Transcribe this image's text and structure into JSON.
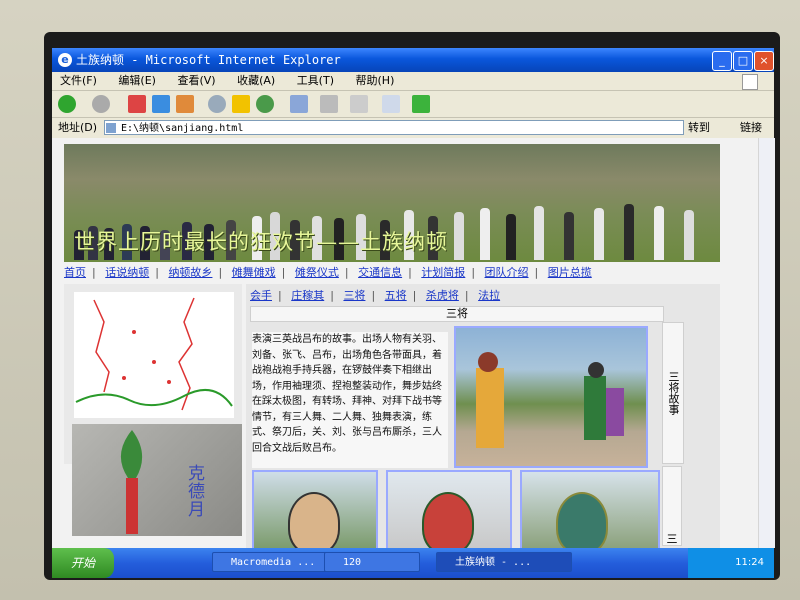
{
  "window": {
    "title": "土族纳顿 - Microsoft Internet Explorer",
    "controls": [
      "_",
      "□",
      "×"
    ]
  },
  "menu": [
    "文件(F)",
    "编辑(E)",
    "查看(V)",
    "收藏(A)",
    "工具(T)",
    "帮助(H)"
  ],
  "address": {
    "label": "地址(D)",
    "value": "E:\\纳顿\\sanjiang.html",
    "go_label": "转到",
    "links_label": "链接"
  },
  "page": {
    "banner_text": "世界上历时最长的狂欢节——土族纳顿",
    "nav": [
      "首页",
      "话说纳顿",
      "纳顿故乡",
      "傩舞傩戏",
      "傩祭仪式",
      "交通信息",
      "计划简报",
      "团队介绍",
      "图片总揽"
    ],
    "subnav": [
      "会手",
      "庄稼其",
      "三将",
      "五将",
      "杀虎将",
      "法拉"
    ],
    "section_title": "三将",
    "side_title": "三将故事",
    "side_title2": "三将",
    "article": "表演三英战吕布的故事。出场人物有关羽、刘备、张飞、吕布，出场角色各带面具，着战袍战袍手持兵器，在锣鼓伴奏下相继出场，作用袖理须、捏袍整装动作，舞步姑终在踩太极图，有转场、拜神、对拜下战书等情节，有三人舞、二人舞、独舞表演，练式、祭刀后，关、刘、张与吕布厮杀，三人回合文战后败吕布。",
    "left_image_text": "克德月"
  },
  "taskbar": {
    "start_label": "开始",
    "tasks": [
      "Macromedia ...",
      "120",
      "土族纳顿 - ..."
    ],
    "clock": "11:24"
  },
  "colors": {
    "title_blue": "#0a57dc",
    "link_blue": "#1a37c8",
    "banner_text": "#e8f79a",
    "thumb_border": "#9aa9ff"
  }
}
